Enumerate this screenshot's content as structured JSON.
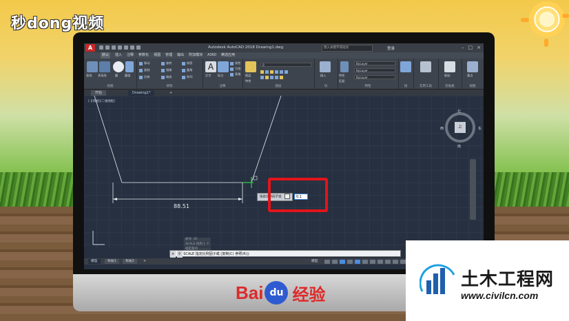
{
  "watermark_top": "秒dong视频",
  "app": {
    "title": "Autodesk AutoCAD 2018   Drawing1.dwg",
    "search_placeholder": "键入关键字或短语",
    "login_label": "登录"
  },
  "menu": [
    "默认",
    "插入",
    "注释",
    "参数化",
    "视图",
    "管理",
    "输出",
    "附加模块",
    "A360",
    "精选应用"
  ],
  "ribbon": {
    "draw_items": [
      "直线",
      "多段线",
      "圆",
      "圆弧"
    ],
    "draw_label": "绘图",
    "modify_items": [
      "移动",
      "旋转",
      "修剪",
      "复制",
      "镜像",
      "圆角",
      "拉伸",
      "缩放",
      "阵列"
    ],
    "modify_label": "修改",
    "annotation_items": [
      "文字",
      "标注",
      "线性",
      "引线",
      "表格"
    ],
    "annotation_label": "注释",
    "layer_items": [
      "图层",
      "特性"
    ],
    "layer_current": "0",
    "layer_label": "图层",
    "block_items": [
      "插入"
    ],
    "block_label": "块",
    "props_items": [
      "特性",
      "匹配"
    ],
    "props_bylayer": [
      "ByLayer",
      "ByLayer",
      "ByLayer"
    ],
    "props_label": "特性",
    "group_label": "组",
    "util_label": "实用工具",
    "clipboard_label": "剪贴板",
    "clipboard_items": [
      "粘贴"
    ],
    "view_label": "视图",
    "view_items": [
      "基点"
    ]
  },
  "doc_tabs": [
    "开始",
    "Drawing1*"
  ],
  "viewport_label": "[-][俯视][二维线框]",
  "viewcube": {
    "face": "上",
    "n": "北",
    "s": "南",
    "w": "西",
    "e": "东"
  },
  "dimension_value": "88.51",
  "tooltip": {
    "prompt": "指定比例因子或"
  },
  "dynamic_input": "0.1",
  "command_history": [
    "命令: SC",
    "SCALE 找到 1 个",
    "指定基点:"
  ],
  "command_line": "SCALE 指定比例因子或 [复制(C) 参照(R)]:",
  "layout_tabs": [
    "模型",
    "布局1",
    "布局2"
  ],
  "status_model": "模型",
  "bottom_brand": {
    "b1": "Bai",
    "paw": "du",
    "b2": "经验"
  },
  "civil": {
    "title": "土木工程网",
    "url": "www.civilcn.com"
  }
}
